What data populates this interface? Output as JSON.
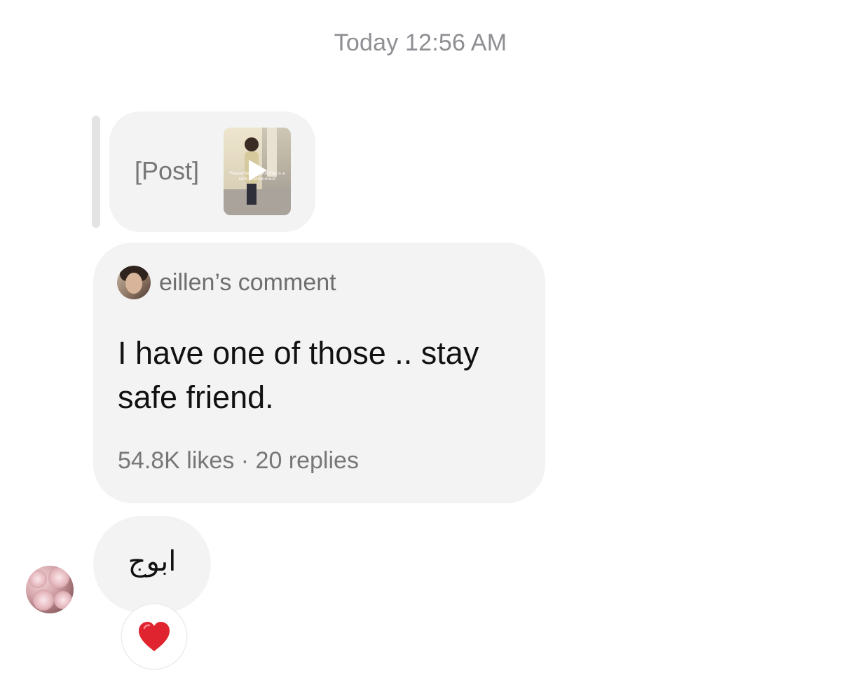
{
  "thread": {
    "timestamp": "Today 12:56 AM"
  },
  "shared_post": {
    "label": "[Post]",
    "thumbnail": {
      "caption": "Please be mindful this is a safe environment",
      "icon": "play-icon"
    }
  },
  "quoted_comment": {
    "author_line": "eillen’s comment",
    "text": "I have one of those .. stay safe friend.",
    "stats": "54.8K likes · 20 replies"
  },
  "reply": {
    "text": "ابوج",
    "reaction": "heart-icon",
    "reaction_color": "#e0242f"
  },
  "colors": {
    "bubble": "#f3f3f3",
    "muted_text": "#8e8e93",
    "primary_text": "#111111"
  }
}
